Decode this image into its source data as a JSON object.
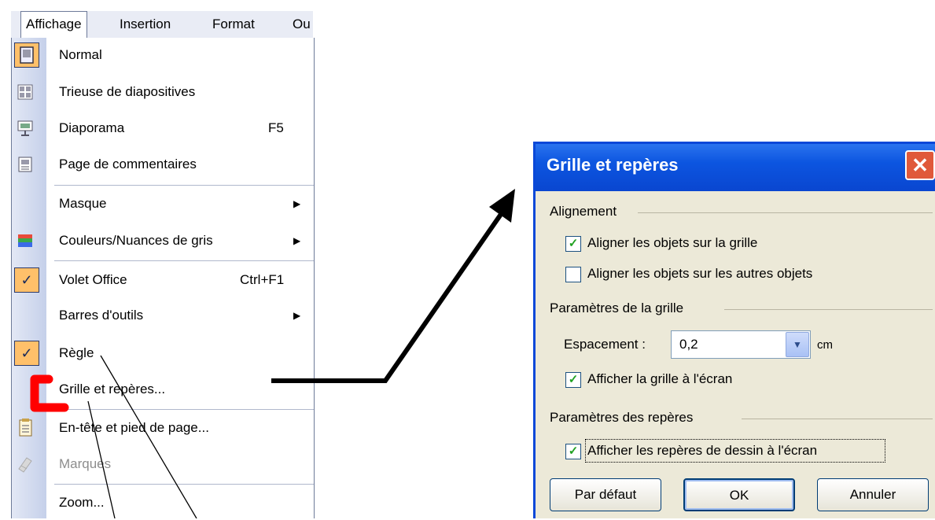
{
  "menubar": {
    "items": [
      {
        "label": "Affichage",
        "active": true
      },
      {
        "label": "Insertion"
      },
      {
        "label": "Format"
      },
      {
        "label": "Ou"
      }
    ]
  },
  "menu": {
    "normal": {
      "label": "Normal"
    },
    "sorter": {
      "label": "Trieuse de diapositives"
    },
    "slideshow": {
      "label": "Diaporama",
      "shortcut": "F5"
    },
    "notes": {
      "label": "Page de commentaires"
    },
    "master": {
      "label": "Masque"
    },
    "color": {
      "label": "Couleurs/Nuances de gris"
    },
    "taskpane": {
      "label": "Volet Office",
      "shortcut": "Ctrl+F1",
      "checked": true
    },
    "toolbars": {
      "label": "Barres d'outils"
    },
    "ruler": {
      "label": "Règle",
      "checked": true
    },
    "grid": {
      "label": "Grille et repères..."
    },
    "header": {
      "label": "En-tête et pied de page..."
    },
    "markup": {
      "label": "Marques",
      "disabled": true
    },
    "zoom": {
      "label": "Zoom..."
    }
  },
  "dialog": {
    "title": "Grille et repères",
    "alignment": {
      "label": "Alignement",
      "snap_grid": {
        "label": "Aligner les objets sur la grille",
        "checked": true
      },
      "snap_objects": {
        "label": "Aligner les objets sur les autres objets",
        "checked": false
      }
    },
    "grid_settings": {
      "label": "Paramètres de la grille",
      "spacing_label": "Espacement :",
      "spacing_value": "0,2",
      "unit": "cm",
      "show_grid": {
        "label": "Afficher la grille à l'écran",
        "checked": true
      }
    },
    "guide_settings": {
      "label": "Paramètres des repères",
      "show_guides": {
        "label": "Afficher les repères de dessin à l'écran",
        "checked": true
      }
    },
    "buttons": {
      "default": "Par défaut",
      "ok": "OK",
      "cancel": "Annuler"
    }
  },
  "colors": {
    "accent": "#0a48d8",
    "highlight": "#ffc06a",
    "annotation": "#ff0000"
  }
}
